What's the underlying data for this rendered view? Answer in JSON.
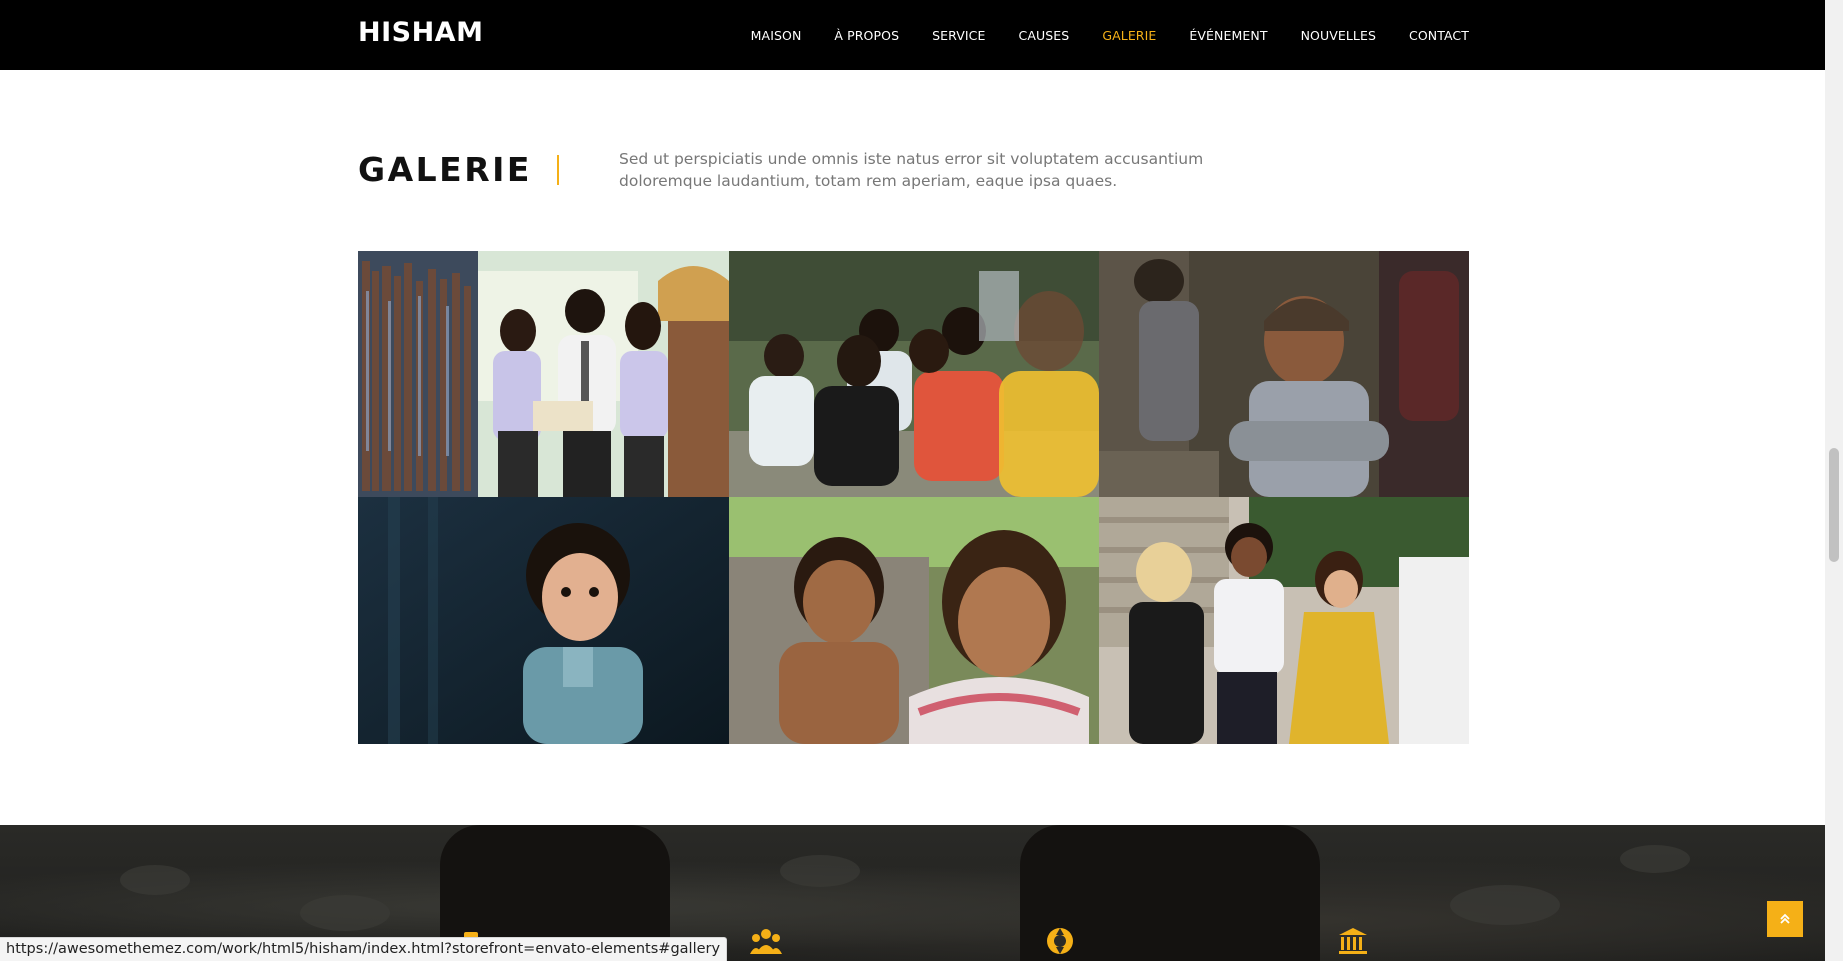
{
  "header": {
    "logo": "HISHAM",
    "nav": [
      {
        "label": "MAISON",
        "active": false
      },
      {
        "label": "À PROPOS",
        "active": false
      },
      {
        "label": "SERVICE",
        "active": false
      },
      {
        "label": "CAUSES",
        "active": false
      },
      {
        "label": "GALERIE",
        "active": true
      },
      {
        "label": "ÉVÉNEMENT",
        "active": false
      },
      {
        "label": "NOUVELLES",
        "active": false
      },
      {
        "label": "CONTACT",
        "active": false
      }
    ]
  },
  "gallery": {
    "title": "GALERIE",
    "description": "Sed ut perspiciatis unde omnis iste natus error sit voluptatem accusantium doloremque laudantium, totam rem aperiam, eaque ipsa quaes.",
    "images": [
      {
        "name": "students-in-library-photo"
      },
      {
        "name": "children-sitting-eating-photo"
      },
      {
        "name": "smiling-boy-with-cap-photo"
      },
      {
        "name": "curly-haired-toddler-photo"
      },
      {
        "name": "smiling-children-photo"
      },
      {
        "name": "teenagers-talking-photo"
      }
    ]
  },
  "features": {
    "icons": [
      "mug-icon",
      "users-icon",
      "lifebuoy-icon",
      "bank-icon"
    ]
  },
  "status_bar": {
    "url": "https://awesomethemez.com/work/html5/hisham/index.html?storefront=envato-elements#gallery"
  },
  "colors": {
    "accent": "#f5b017",
    "header_bg": "#000000",
    "text_muted": "#777777"
  }
}
